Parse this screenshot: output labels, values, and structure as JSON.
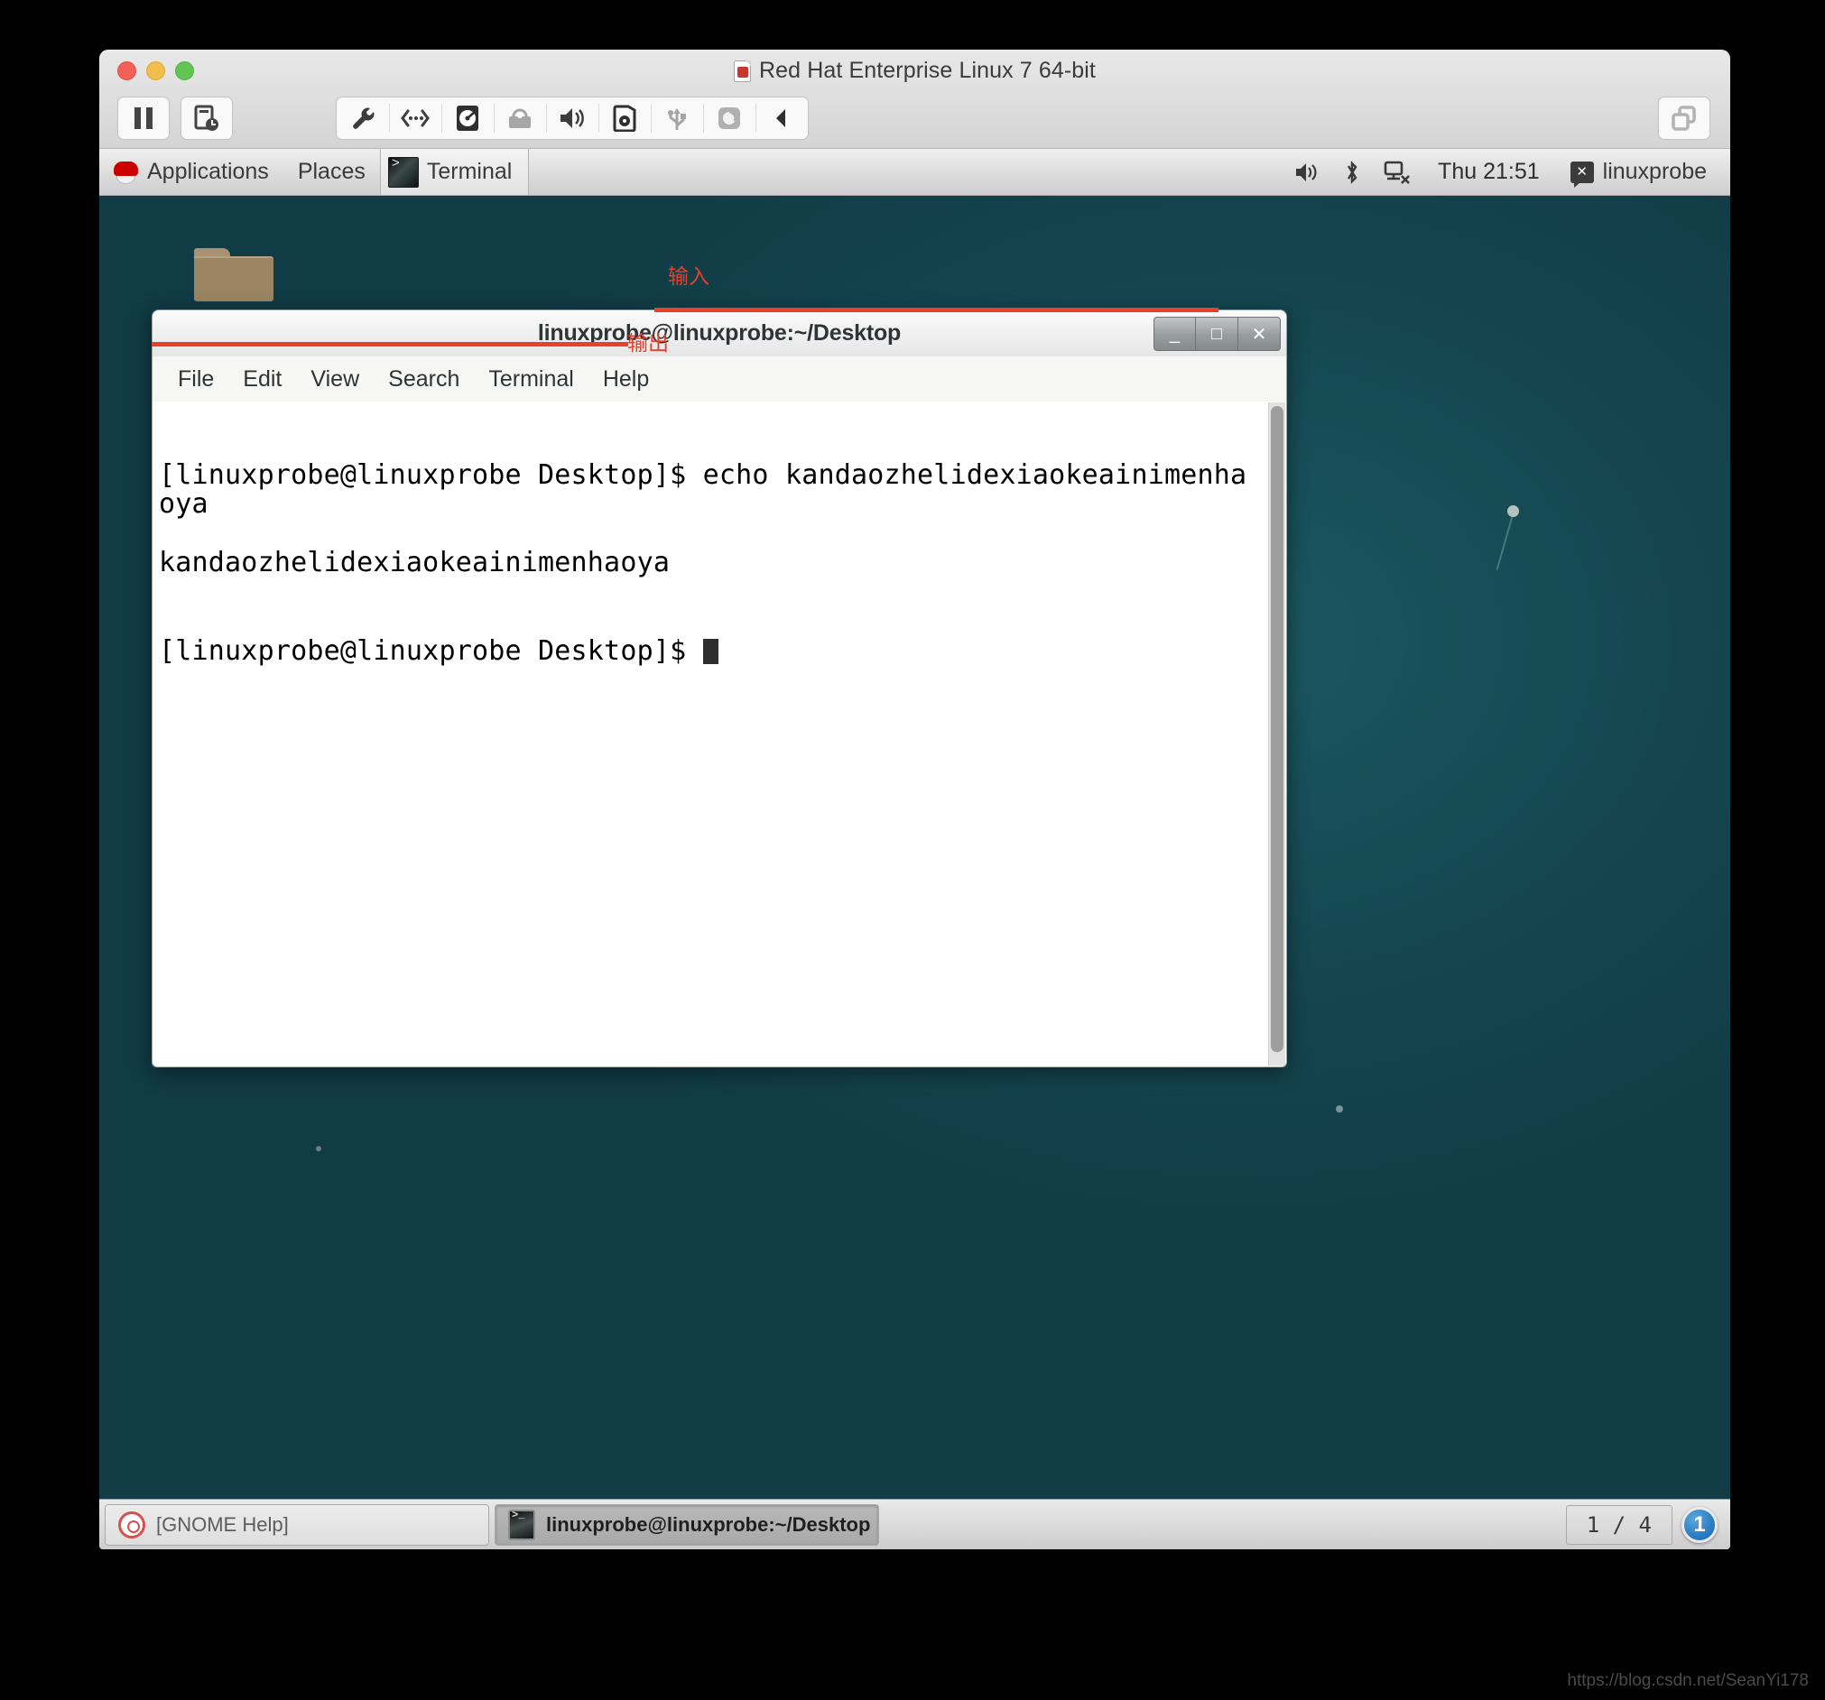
{
  "vm": {
    "title": "Red Hat Enterprise Linux 7 64-bit",
    "toolbar": {
      "pause_label": "Pause",
      "snapshot_label": "Snapshot",
      "settings_label": "Settings",
      "network_label": "Network Adapter",
      "harddisk_label": "Hard Disk",
      "printer_label": "Printer",
      "sound_label": "Sound Card",
      "cd_label": "CD/DVD",
      "usb_label": "USB",
      "camera_label": "Camera",
      "collapse_label": "Collapse toolbar",
      "unity_label": "Unity View"
    }
  },
  "gnome_panel": {
    "applications": "Applications",
    "places": "Places",
    "active_app": "Terminal",
    "clock": "Thu 21:51",
    "user": "linuxprobe"
  },
  "terminal_window": {
    "title": "linuxprobe@linuxprobe:~/Desktop",
    "menus": [
      "File",
      "Edit",
      "View",
      "Search",
      "Terminal",
      "Help"
    ],
    "window_buttons": {
      "minimize": "_",
      "maximize": "□",
      "close": "✕"
    },
    "lines": [
      {
        "prompt": "[linuxprobe@linuxprobe Desktop]$ ",
        "text": "echo kandaozhelidexiaokeainimenhaoya"
      },
      {
        "prompt": "",
        "text": "kandaozhelidexiaokeainimenhaoya"
      },
      {
        "prompt": "[linuxprobe@linuxprobe Desktop]$ ",
        "text": ""
      }
    ]
  },
  "annotations": {
    "input_label": "输入",
    "output_label": "输出",
    "accent_color": "#e8402a"
  },
  "taskbar": {
    "items": [
      {
        "label": "[GNOME Help]",
        "icon": "help-icon",
        "active": false
      },
      {
        "label": "linuxprobe@linuxprobe:~/Desktop",
        "icon": "terminal-icon",
        "active": true
      }
    ],
    "workspace_count": "1 / 4",
    "workspace_current": "1"
  },
  "watermark": "https://blog.csdn.net/SeanYi178"
}
